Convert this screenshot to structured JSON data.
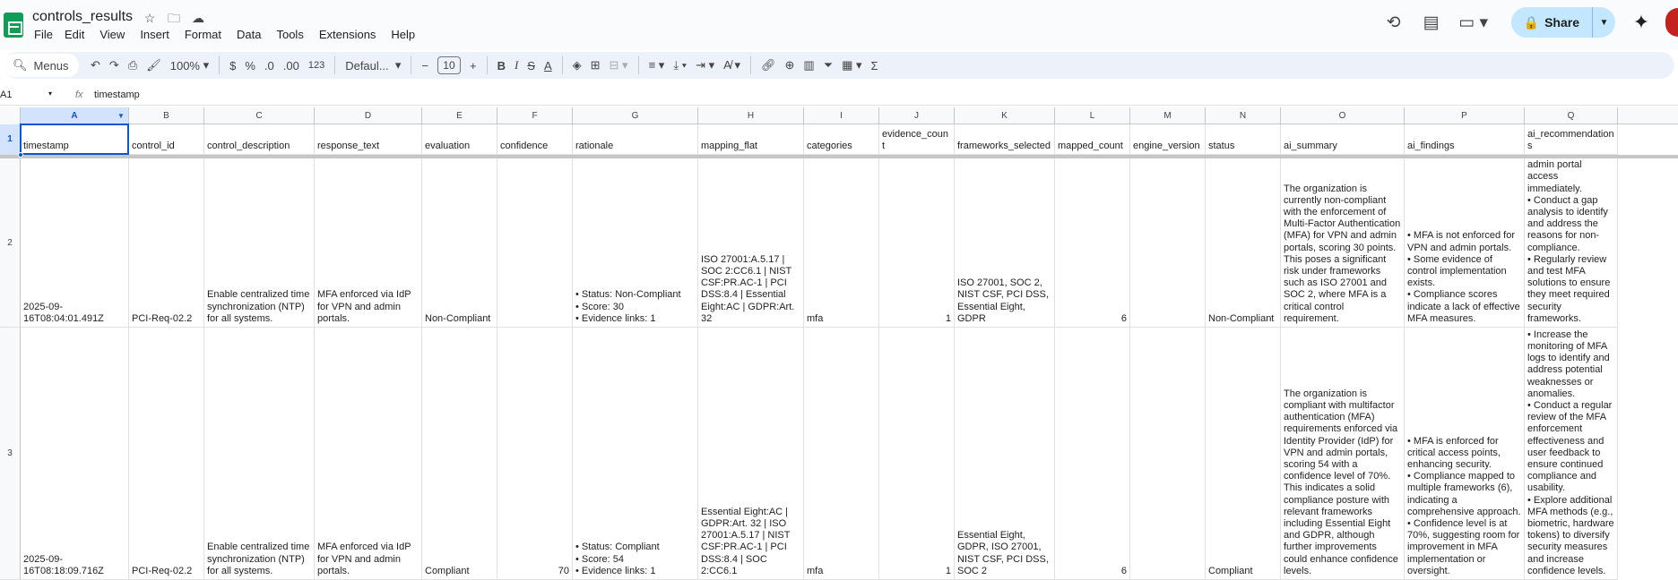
{
  "app": {
    "doc_title": "controls_results",
    "menu": [
      "File",
      "Edit",
      "View",
      "Insert",
      "Format",
      "Data",
      "Tools",
      "Extensions",
      "Help"
    ],
    "share_label": "Share"
  },
  "toolbar": {
    "search_label": "Menus",
    "zoom": "100%",
    "currency": "$",
    "percent": "%",
    "dec_decrease": ".0",
    "dec_increase": ".00",
    "number_format": "123",
    "font": "Defaul...",
    "font_size": "10"
  },
  "formula_bar": {
    "cell_ref": "A1",
    "fx": "fx",
    "value": "timestamp"
  },
  "columns": [
    {
      "letter": "A",
      "header": "timestamp"
    },
    {
      "letter": "B",
      "header": "control_id"
    },
    {
      "letter": "C",
      "header": "control_description"
    },
    {
      "letter": "D",
      "header": "response_text"
    },
    {
      "letter": "E",
      "header": "evaluation"
    },
    {
      "letter": "F",
      "header": "confidence"
    },
    {
      "letter": "G",
      "header": "rationale"
    },
    {
      "letter": "H",
      "header": "mapping_flat"
    },
    {
      "letter": "I",
      "header": "categories"
    },
    {
      "letter": "J",
      "header": "evidence_count"
    },
    {
      "letter": "K",
      "header": "frameworks_selected"
    },
    {
      "letter": "L",
      "header": "mapped_count"
    },
    {
      "letter": "M",
      "header": "engine_version"
    },
    {
      "letter": "N",
      "header": "status"
    },
    {
      "letter": "O",
      "header": "ai_summary"
    },
    {
      "letter": "P",
      "header": "ai_findings"
    },
    {
      "letter": "Q",
      "header": "ai_recommendations"
    }
  ],
  "rows": [
    {
      "num": "2",
      "cells": [
        "2025-09-16T08:04:01.491Z",
        "PCI-Req-02.2",
        "Enable centralized time synchronization (NTP) for all systems.",
        "MFA enforced via IdP for VPN and admin portals.",
        "Non-Compliant",
        "",
        "• Status: Non-Compliant\n• Score: 30\n• Evidence links: 1",
        "ISO 27001:A.5.17 | SOC 2:CC6.1 | NIST CSF:PR.AC-1 | PCI DSS:8.4 | Essential Eight:AC | GDPR:Art. 32",
        "mfa",
        "1",
        "ISO 27001, SOC 2, NIST CSF, PCI DSS, Essential Eight, GDPR",
        "6",
        "",
        "Non-Compliant",
        "The organization is currently non-compliant with the enforcement of Multi-Factor Authentication (MFA) for VPN and admin portals, scoring 30 points. This poses a significant risk under frameworks such as ISO 27001 and SOC 2, where MFA is a critical control requirement.",
        "• MFA is not enforced for VPN and admin portals.\n• Some evidence of control implementation exists.\n• Compliance scores indicate a lack of effective MFA measures.",
        "• Implement MFA for all VPN and admin portal access immediately.\n• Conduct a gap analysis to identify and address the reasons for non-compliance.\n• Regularly review and test MFA solutions to ensure they meet required security frameworks."
      ]
    },
    {
      "num": "3",
      "cells": [
        "2025-09-16T08:18:09.716Z",
        "PCI-Req-02.2",
        "Enable centralized time synchronization (NTP) for all systems.",
        "MFA enforced via IdP for VPN and admin portals.",
        "Compliant",
        "70",
        "• Status: Compliant\n• Score: 54\n• Evidence links: 1",
        "Essential Eight:AC | GDPR:Art. 32 | ISO 27001:A.5.17 | NIST CSF:PR.AC-1 | PCI DSS:8.4 | SOC 2:CC6.1",
        "mfa",
        "1",
        "Essential Eight, GDPR, ISO 27001, NIST CSF, PCI DSS, SOC 2",
        "6",
        "",
        "Compliant",
        "The organization is compliant with multifactor authentication (MFA) requirements enforced via Identity Provider (IdP) for VPN and admin portals, scoring 54 with a confidence level of 70%. This indicates a solid compliance posture with relevant frameworks including Essential Eight and GDPR, although further improvements could enhance confidence levels.",
        "• MFA is enforced for critical access points, enhancing security.\n• Compliance mapped to multiple frameworks (6), indicating a comprehensive approach.\n• Confidence level is at 70%, suggesting room for improvement in MFA implementation or oversight.",
        "• Increase the monitoring of MFA logs to identify and address potential weaknesses or anomalies.\n• Conduct a regular review of the MFA enforcement effectiveness and user feedback to ensure continued compliance and usability.\n• Explore additional MFA methods (e.g., biometric, hardware tokens) to diversify security measures and increase confidence levels."
      ]
    }
  ],
  "colors": {
    "accent": "#0b57d0",
    "share_bg": "#c2e7ff",
    "logo": "#0f9d58"
  }
}
